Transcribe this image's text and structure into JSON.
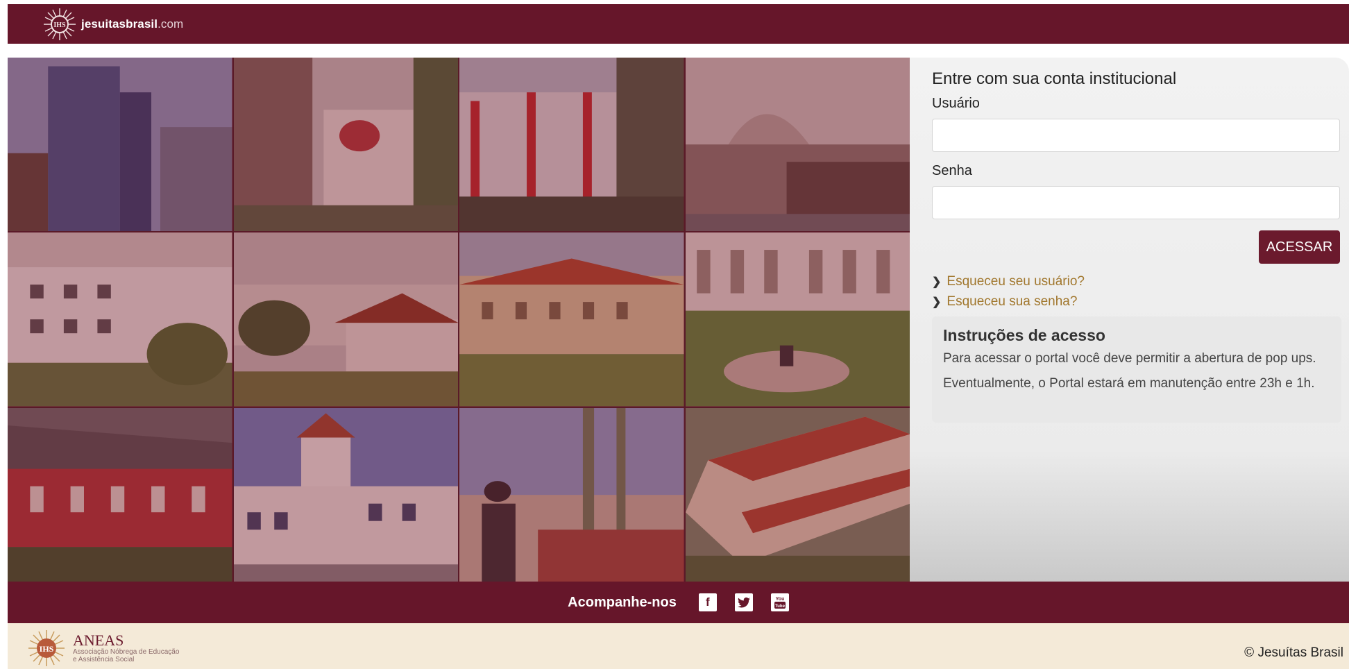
{
  "header": {
    "brand_name": "jesuitasbrasil",
    "brand_suffix": ".com",
    "logo_icon": "jesuit-seal-icon"
  },
  "login": {
    "title": "Entre com sua conta institucional",
    "username_label": "Usuário",
    "username_value": "",
    "password_label": "Senha",
    "password_value": "",
    "submit_label": "ACESSAR",
    "forgot_user": "Esqueceu seu usuário?",
    "forgot_password": "Esqueceu sua senha?"
  },
  "instructions": {
    "title": "Instruções de acesso",
    "line1": "Para acessar o portal você deve permitir a abertura de pop ups.",
    "line2": "Eventualmente, o Portal estará em manutenção entre 23h e 1h."
  },
  "social": {
    "label": "Acompanhe-nos",
    "items": [
      {
        "name": "facebook-icon",
        "glyph": "f"
      },
      {
        "name": "twitter-icon",
        "glyph": "t"
      },
      {
        "name": "youtube-icon",
        "glyph": "▶"
      }
    ]
  },
  "footer": {
    "org_name": "ANEAS",
    "org_subtitle_1": "Associação Nóbrega de Educação",
    "org_subtitle_2": "e Assistência Social",
    "copyright": "© Jesuítas Brasil"
  },
  "mosaic": {
    "photo_icons": [
      "building-photo",
      "loyola-school-photo",
      "school-facade-photo",
      "arched-building-photo",
      "white-building-photo",
      "campus-photo",
      "courtyard-photo",
      "garden-bell-photo",
      "red-building-photo",
      "church-photo",
      "statue-photo",
      "aerial-campus-photo"
    ]
  },
  "colors": {
    "brand": "#66162a",
    "link": "#a1772d",
    "footer_bg": "#f4ead8"
  }
}
